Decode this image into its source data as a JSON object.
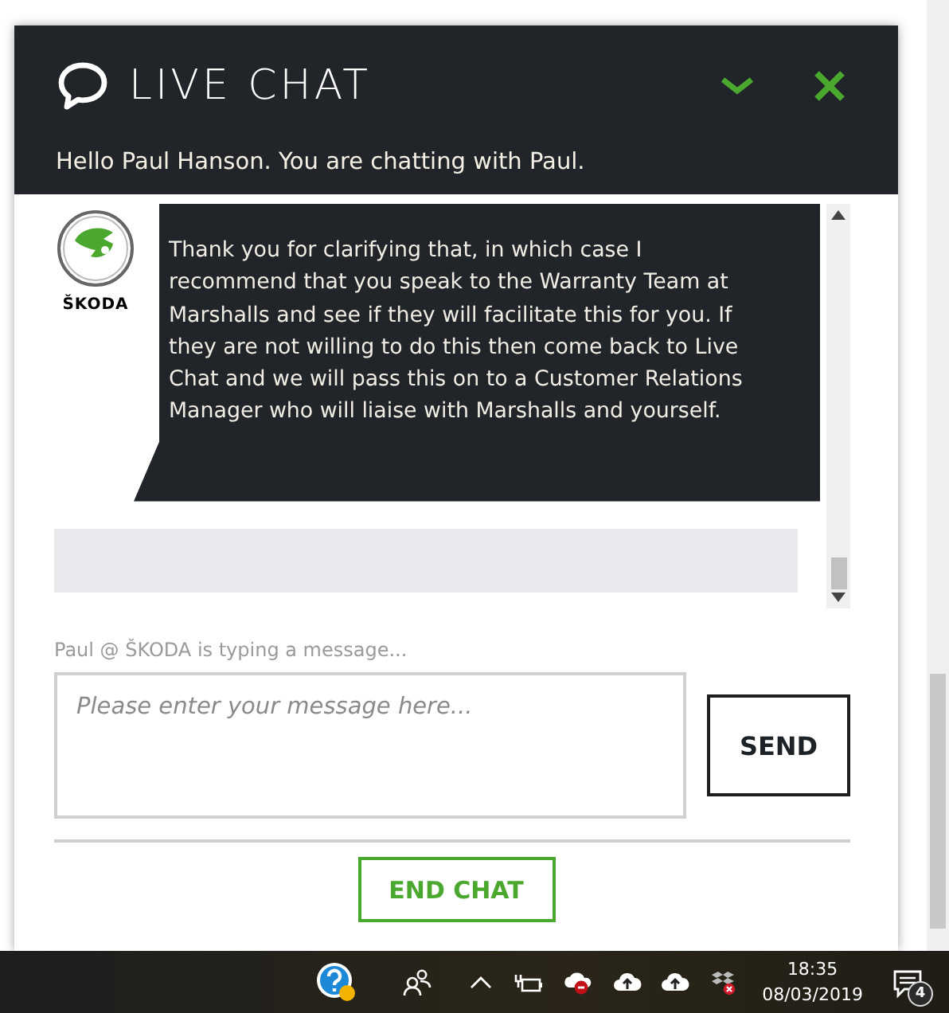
{
  "chat": {
    "title": "LIVE CHAT",
    "greeting": "Hello Paul Hanson. You are chatting with Paul.",
    "messages": [
      {
        "kind": "agent",
        "brand": "ŠKODA",
        "text": "Thank you for clarifying that, in which case I recommend that you speak to the Warranty Team at Marshalls and see if they will facilitate this for you. If they are not willing to do this then come back to Live Chat and we will pass this on to a Customer Relations Manager who will liaise with Marshalls and yourself."
      },
      {
        "kind": "user"
      }
    ],
    "typing_status": "Paul @ ŠKODA is typing a message...",
    "input": {
      "placeholder": "Please enter your message here..."
    },
    "send_button": "SEND",
    "end_button": "END CHAT"
  },
  "taskbar": {
    "time": "18:35",
    "date": "08/03/2019",
    "notification_count": "4"
  }
}
